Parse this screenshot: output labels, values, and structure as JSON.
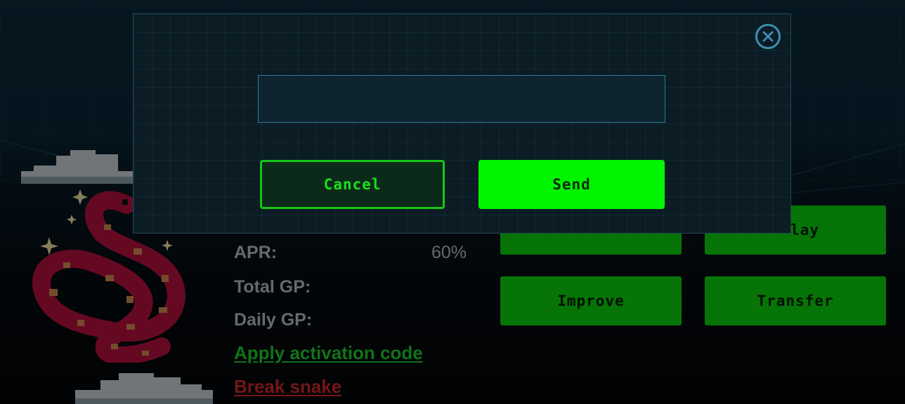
{
  "stats": {
    "apr_label": "APR:",
    "apr_value": "60%",
    "total_gp_label": "Total GP:",
    "daily_gp_label": "Daily GP:"
  },
  "links": {
    "apply_code": "Apply activation code",
    "break_snake": "Break snake"
  },
  "actions": {
    "top_right_partial": "lay",
    "improve": "Improve",
    "transfer": "Transfer"
  },
  "modal": {
    "input_value": "",
    "cancel_label": "Cancel",
    "send_label": "Send"
  },
  "icons": [
    "close-icon",
    "snake-icon",
    "cloud-icon",
    "sparkle-icon"
  ],
  "colors": {
    "accent_green": "#00f500",
    "button_green": "#0bd40b",
    "danger_red": "#d3272c",
    "modal_border": "#1f4656",
    "close_blue": "#3b8fb0"
  }
}
